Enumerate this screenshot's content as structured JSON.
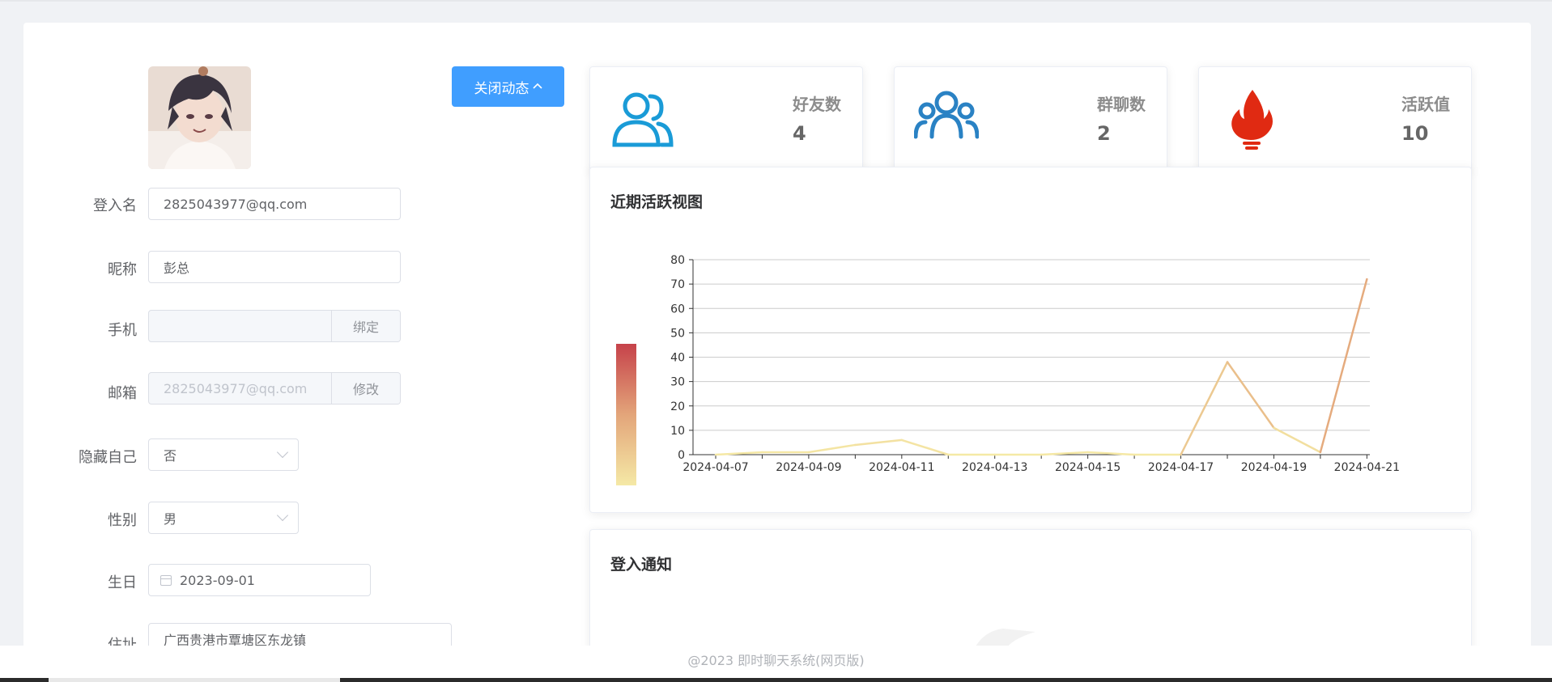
{
  "profile": {
    "toggle_button": "关闭动态",
    "toggle_icon": "chevron-up-icon",
    "fields": {
      "login": {
        "label": "登入名",
        "value": "2825043977@qq.com"
      },
      "nickname": {
        "label": "昵称",
        "value": "彭总"
      },
      "phone": {
        "label": "手机",
        "value": "",
        "action": "绑定"
      },
      "email": {
        "label": "邮箱",
        "value": "2825043977@qq.com",
        "action": "修改"
      },
      "hide_self": {
        "label": "隐藏自己",
        "value": "否"
      },
      "gender": {
        "label": "性别",
        "value": "男"
      },
      "birthday": {
        "label": "生日",
        "value": "2023-09-01"
      },
      "address": {
        "label": "住址",
        "value": "广西贵港市覃塘区东龙镇"
      }
    }
  },
  "stats": [
    {
      "label": "好友数",
      "value": "4",
      "icon": "friends-icon",
      "color": "#1a9bd7"
    },
    {
      "label": "群聊数",
      "value": "2",
      "icon": "group-icon",
      "color": "#2a82c4"
    },
    {
      "label": "活跃值",
      "value": "10",
      "icon": "fire-icon",
      "color": "#e02a12"
    }
  ],
  "activity": {
    "title": "近期活跃视图",
    "colors": {
      "low": "#f5e9a6",
      "mid": "#e3a57a",
      "high": "#c6424a"
    }
  },
  "chart_data": {
    "type": "line",
    "x": [
      "2024-04-07",
      "2024-04-08",
      "2024-04-09",
      "2024-04-10",
      "2024-04-11",
      "2024-04-12",
      "2024-04-13",
      "2024-04-14",
      "2024-04-15",
      "2024-04-16",
      "2024-04-17",
      "2024-04-18",
      "2024-04-19",
      "2024-04-20",
      "2024-04-21"
    ],
    "x_tick_labels": [
      "2024-04-07",
      "2024-04-09",
      "2024-04-11",
      "2024-04-13",
      "2024-04-15",
      "2024-04-17",
      "2024-04-19",
      "2024-04-21"
    ],
    "series": [
      {
        "values": [
          0,
          1,
          1,
          4,
          6,
          0,
          0,
          0,
          1,
          0,
          0,
          38,
          11,
          1,
          72
        ]
      }
    ],
    "ylim": [
      0,
      80
    ],
    "y_ticks": [
      0,
      10,
      20,
      30,
      40,
      50,
      60,
      70,
      80
    ],
    "grid": true,
    "visual_map": "vertical gradient bar on the left"
  },
  "login_notice": {
    "title": "登入通知"
  },
  "footer": {
    "text": "@2023 即时聊天系统(网页版)"
  }
}
